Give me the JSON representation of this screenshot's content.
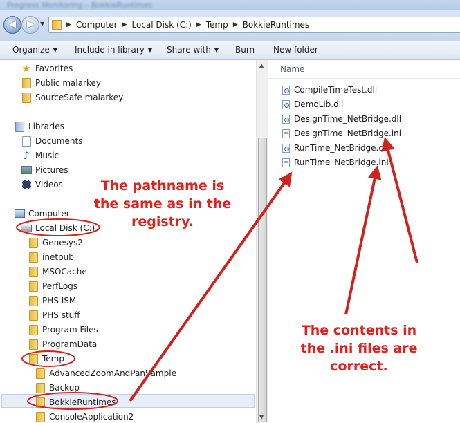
{
  "window": {
    "blurred_title": "Progress Monitoring – BokkieRuntimes"
  },
  "address": {
    "crumbs": [
      "Computer",
      "Local Disk (C:)",
      "Temp",
      "BokkieRuntimes"
    ]
  },
  "toolbar": {
    "organize": "Organize",
    "include": "Include in library",
    "share": "Share with",
    "burn": "Burn",
    "new_folder": "New folder"
  },
  "nav": {
    "favorites": "Favorites",
    "public": "Public malarkey",
    "sourcesafe": "SourceSafe malarkey",
    "libraries": "Libraries",
    "documents": "Documents",
    "music": "Music",
    "pictures": "Pictures",
    "videos": "Videos",
    "computer": "Computer",
    "local_disk": "Local Disk (C:)",
    "folders_c": [
      "Genesys2",
      "inetpub",
      "MSOCache",
      "PerfLogs",
      "PHS ISM",
      "PHS stuff",
      "Program Files",
      "ProgramData"
    ],
    "temp": "Temp",
    "folders_temp": [
      "AdvancedZoomAndPanSample",
      "Backup",
      "BokkieRuntimes",
      "ConsoleApplication2"
    ]
  },
  "files": {
    "column_name": "Name",
    "items": [
      "CompileTimeTest.dll",
      "DemoLib.dll",
      "DesignTime_NetBridge.dll",
      "DesignTime_NetBridge.ini",
      "RunTime_NetBridge.dll",
      "RunTime_NetBridge.ini"
    ]
  },
  "annotations": {
    "pathname": [
      "The pathname is",
      "the same as in the",
      "registry."
    ],
    "contents": [
      "The contents in",
      "the .ini files are",
      "correct."
    ]
  },
  "colors": {
    "annotation_red": "#e3201b"
  }
}
